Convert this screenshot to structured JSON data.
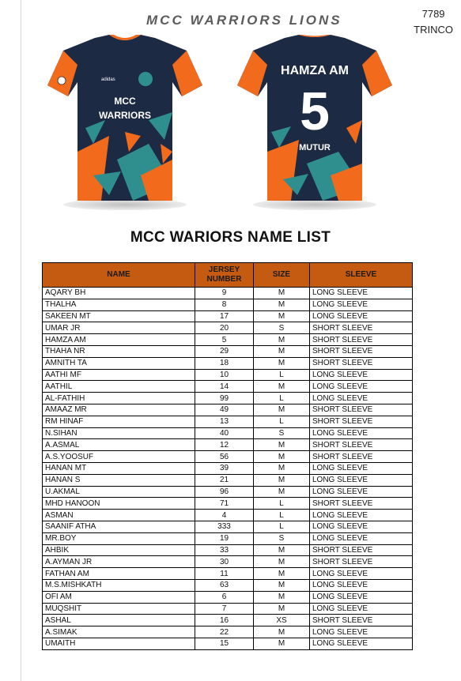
{
  "order": {
    "number": "7789",
    "location": "TRINCO"
  },
  "brand_title": "MCC WARRIORS LIONS",
  "jersey_front": {
    "chest_text_line1": "MCC",
    "chest_text_line2": "WARRIORS",
    "maker": "adidas"
  },
  "jersey_back": {
    "player_name": "HAMZA AM",
    "number": "5",
    "lower_text": "MUTUR"
  },
  "colors": {
    "navy": "#1c2a44",
    "orange": "#f26a1b",
    "teal": "#2f8f8f",
    "header": "#c55a11"
  },
  "list_title": "MCC WARIORS NAME LIST",
  "table": {
    "headers": {
      "name": "NAME",
      "jersey_line1": "JERSEY",
      "jersey_line2": "NUMBER",
      "size": "SIZE",
      "sleeve": "SLEEVE"
    },
    "rows": [
      {
        "name": "AQARY BH",
        "number": "9",
        "size": "M",
        "sleeve": "LONG SLEEVE"
      },
      {
        "name": "THALHA",
        "number": "8",
        "size": "M",
        "sleeve": "LONG SLEEVE"
      },
      {
        "name": "SAKEEN MT",
        "number": "17",
        "size": "M",
        "sleeve": "LONG SLEEVE"
      },
      {
        "name": "UMAR JR",
        "number": "20",
        "size": "S",
        "sleeve": "SHORT SLEEVE"
      },
      {
        "name": "HAMZA AM",
        "number": "5",
        "size": "M",
        "sleeve": "SHORT SLEEVE"
      },
      {
        "name": "THAHA NR",
        "number": "29",
        "size": "M",
        "sleeve": "SHORT SLEEVE"
      },
      {
        "name": "AMNITH TA",
        "number": "18",
        "size": "M",
        "sleeve": "SHORT SLEEVE"
      },
      {
        "name": "AATHI MF",
        "number": "10",
        "size": "L",
        "sleeve": "LONG SLEEVE"
      },
      {
        "name": "AATHIL",
        "number": "14",
        "size": "M",
        "sleeve": "LONG SLEEVE"
      },
      {
        "name": "AL-FATHIH",
        "number": "99",
        "size": "L",
        "sleeve": "LONG SLEEVE"
      },
      {
        "name": "AMAAZ MR",
        "number": "49",
        "size": "M",
        "sleeve": "SHORT SLEEVE"
      },
      {
        "name": "RM HINAF",
        "number": "13",
        "size": "L",
        "sleeve": "SHORT SLEEVE"
      },
      {
        "name": "N.SIHAN",
        "number": "40",
        "size": "S",
        "sleeve": "LONG SLEEVE"
      },
      {
        "name": "A.ASMAL",
        "number": "12",
        "size": "M",
        "sleeve": "SHORT SLEEVE"
      },
      {
        "name": "A.S.YOOSUF",
        "number": "56",
        "size": "M",
        "sleeve": "SHORT SLEEVE"
      },
      {
        "name": "HANAN MT",
        "number": "39",
        "size": "M",
        "sleeve": "LONG SLEEVE"
      },
      {
        "name": "HANAN S",
        "number": "21",
        "size": "M",
        "sleeve": "LONG SLEEVE"
      },
      {
        "name": "U.AKMAL",
        "number": "96",
        "size": "M",
        "sleeve": "LONG SLEEVE"
      },
      {
        "name": "MHD HANOON",
        "number": "71",
        "size": "L",
        "sleeve": "SHORT SLEEVE"
      },
      {
        "name": "ASMAN",
        "number": "4",
        "size": "L",
        "sleeve": "LONG SLEEVE"
      },
      {
        "name": "SAANIF ATHA",
        "number": "333",
        "size": "L",
        "sleeve": "LONG SLEEVE"
      },
      {
        "name": "MR.BOY",
        "number": "19",
        "size": "S",
        "sleeve": "LONG SLEEVE"
      },
      {
        "name": "AHBIK",
        "number": "33",
        "size": "M",
        "sleeve": "SHORT SLEEVE"
      },
      {
        "name": "A.AYMAN JR",
        "number": "30",
        "size": "M",
        "sleeve": "SHORT SLEEVE"
      },
      {
        "name": "FATHAN AM",
        "number": "11",
        "size": "M",
        "sleeve": "LONG SLEEVE"
      },
      {
        "name": "M.S.MISHKATH",
        "number": "63",
        "size": "M",
        "sleeve": "LONG SLEEVE"
      },
      {
        "name": "OFI AM",
        "number": "6",
        "size": "M",
        "sleeve": "LONG SLEEVE"
      },
      {
        "name": "MUQSHIT",
        "number": "7",
        "size": "M",
        "sleeve": "LONG SLEEVE"
      },
      {
        "name": "ASHAL",
        "number": "16",
        "size": "XS",
        "sleeve": "SHORT SLEEVE"
      },
      {
        "name": "A.SIMAK",
        "number": "22",
        "size": "M",
        "sleeve": "LONG SLEEVE"
      },
      {
        "name": "UMAITH",
        "number": "15",
        "size": "M",
        "sleeve": "LONG SLEEVE"
      }
    ]
  }
}
